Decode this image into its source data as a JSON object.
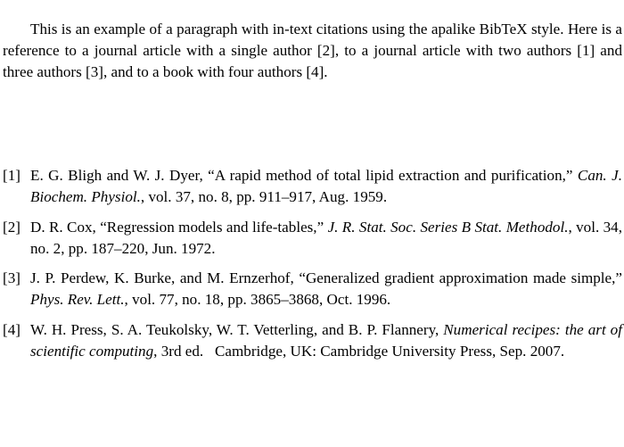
{
  "document": {
    "type": "latex-document-page",
    "background_color": "#ffffff",
    "text_color": "#000000",
    "bib_style_name": "apalike",
    "intro_paragraph": "This is an example of a paragraph with in-text citations using the apalike BibTeX style. Here is a reference to a journal article with a single author [2], to a journal article with two authors [1] and three authors [3], and to a book with four authors [4].",
    "bibliography": {
      "entries": [
        {
          "label": "[1]",
          "authors": "E. G. Bligh and W. J. Dyer,",
          "title": "“A rapid method of total lipid extraction and purification,”",
          "container": "Can. J. Biochem. Physiol.",
          "details": ", vol. 37, no. 8, pp. 911–917, Aug. 1959.",
          "publisher": "",
          "edition": ""
        },
        {
          "label": "[2]",
          "authors": "D. R. Cox,",
          "title": "“Regression models and life-tables,”",
          "container": "J. R. Stat. Soc. Series B Stat. Methodol.",
          "details": ", vol. 34, no. 2, pp. 187–220, Jun. 1972.",
          "publisher": "",
          "edition": ""
        },
        {
          "label": "[3]",
          "authors": "J. P. Perdew, K. Burke, and M. Ernzerhof,",
          "title": "“Generalized gradient approximation made simple,”",
          "container": "Phys. Rev. Lett.",
          "details": ", vol. 77, no. 18, pp. 3865–3868, Oct. 1996.",
          "publisher": "",
          "edition": ""
        },
        {
          "label": "[4]",
          "authors": "W. H. Press, S. A. Teukolsky, W. T. Vetterling, and B. P. Flannery,",
          "title": "",
          "container": "Numerical recipes: the art of scientific computing",
          "details": ", 3rd ed.",
          "publisher": "Cambridge, UK: Cambridge University Press, Sep. 2007.",
          "edition": ""
        }
      ]
    }
  }
}
